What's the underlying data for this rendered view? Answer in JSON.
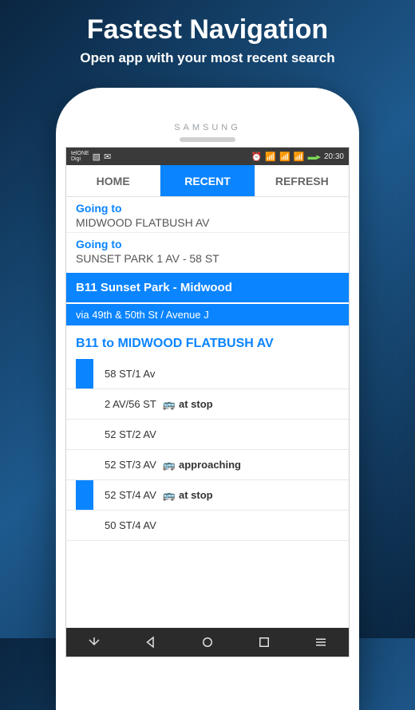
{
  "promo": {
    "title": "Fastest Navigation",
    "subtitle": "Open app with your most recent search"
  },
  "phone_brand": "SAMSUNG",
  "statusbar": {
    "carrier_line1": "telONE",
    "carrier_line2": "Digi",
    "time": "20:30"
  },
  "tabs": [
    {
      "label": "HOME",
      "active": false
    },
    {
      "label": "RECENT",
      "active": true
    },
    {
      "label": "REFRESH",
      "active": false
    }
  ],
  "destinations": [
    {
      "label": "Going to",
      "name": "MIDWOOD FLATBUSH AV"
    },
    {
      "label": "Going to",
      "name": "SUNSET PARK 1 AV - 58 ST"
    }
  ],
  "route": {
    "title": "B11 Sunset Park - Midwood",
    "via": "via 49th & 50th St / Avenue J",
    "direction": "B11 to MIDWOOD FLATBUSH AV"
  },
  "stops": [
    {
      "name": "58 ST/1 Av",
      "status": "",
      "bar": true
    },
    {
      "name": "2 AV/56 ST",
      "status": "at stop",
      "bar": false
    },
    {
      "name": "52 ST/2 AV",
      "status": "",
      "bar": false
    },
    {
      "name": "52 ST/3 AV",
      "status": "approaching",
      "bar": false
    },
    {
      "name": "52 ST/4 AV",
      "status": "at stop",
      "bar": true
    },
    {
      "name": "50 ST/4 AV",
      "status": "",
      "bar": false
    }
  ]
}
